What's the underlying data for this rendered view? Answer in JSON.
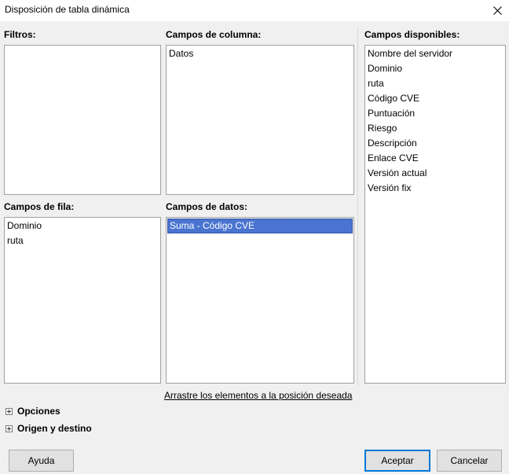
{
  "window": {
    "title": "Disposición de tabla dinámica"
  },
  "filters": {
    "label": "Filtros:",
    "items": []
  },
  "column_fields": {
    "label": "Campos de columna:",
    "items": [
      "Datos"
    ]
  },
  "row_fields": {
    "label": "Campos de fila:",
    "items": [
      "Dominio",
      "ruta"
    ]
  },
  "data_fields": {
    "label": "Campos de datos:",
    "items": [
      "Suma - Código CVE"
    ],
    "selected_index": 0
  },
  "available_fields": {
    "label": "Campos disponibles:",
    "items": [
      "Nombre del servidor",
      "Dominio",
      "ruta",
      "Código CVE",
      "Puntuación",
      "Riesgo",
      "Descripción",
      "Enlace CVE",
      "Versión actual",
      "Versión fix"
    ]
  },
  "hint": "Arrastre los elementos a la posición deseada",
  "expanders": {
    "options": "Opciones",
    "source_dest": "Origen y destino"
  },
  "buttons": {
    "help": "Ayuda",
    "ok": "Aceptar",
    "cancel": "Cancelar"
  },
  "colors": {
    "selection": "#4a74d0",
    "default_button_border": "#0078d7"
  }
}
